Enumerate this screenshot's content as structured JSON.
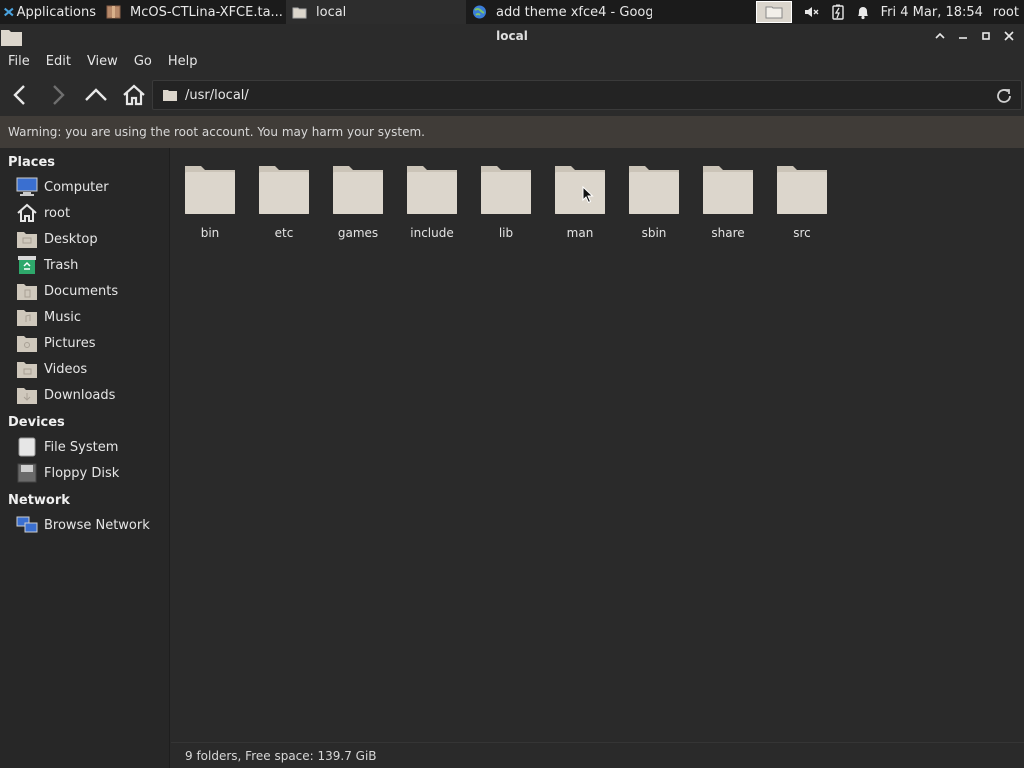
{
  "panel": {
    "applications_label": "Applications",
    "tasks": [
      {
        "label": "McOS-CTLina-XFCE.ta...",
        "icon": "archive-icon"
      },
      {
        "label": "local",
        "icon": "folder-icon"
      },
      {
        "label": "add theme xfce4 - Goog...",
        "icon": "globe-icon"
      }
    ],
    "clock": "Fri  4 Mar, 18:54",
    "user": "root"
  },
  "window": {
    "title": "local",
    "menu": [
      "File",
      "Edit",
      "View",
      "Go",
      "Help"
    ],
    "location": "/usr/local/",
    "warning": "Warning: you are using the root account. You may harm your system."
  },
  "sidebar": {
    "places_header": "Places",
    "places": [
      {
        "label": "Computer",
        "icon": "computer-icon"
      },
      {
        "label": "root",
        "icon": "home-icon"
      },
      {
        "label": "Desktop",
        "icon": "desktop-folder-icon"
      },
      {
        "label": "Trash",
        "icon": "trash-icon"
      },
      {
        "label": "Documents",
        "icon": "documents-folder-icon"
      },
      {
        "label": "Music",
        "icon": "music-folder-icon"
      },
      {
        "label": "Pictures",
        "icon": "pictures-folder-icon"
      },
      {
        "label": "Videos",
        "icon": "videos-folder-icon"
      },
      {
        "label": "Downloads",
        "icon": "downloads-folder-icon"
      }
    ],
    "devices_header": "Devices",
    "devices": [
      {
        "label": "File System",
        "icon": "drive-icon"
      },
      {
        "label": "Floppy Disk",
        "icon": "floppy-icon"
      }
    ],
    "network_header": "Network",
    "network": [
      {
        "label": "Browse Network",
        "icon": "network-icon"
      }
    ]
  },
  "folders": [
    "bin",
    "etc",
    "games",
    "include",
    "lib",
    "man",
    "sbin",
    "share",
    "src"
  ],
  "status": "9 folders, Free space: 139.7 GiB",
  "colors": {
    "folder_fill": "#dcd6cc",
    "folder_tab": "#cbc4b8",
    "panel_bg": "#1b1b1b",
    "window_bg": "#2a2a2a",
    "warning_bg": "#403c38"
  }
}
